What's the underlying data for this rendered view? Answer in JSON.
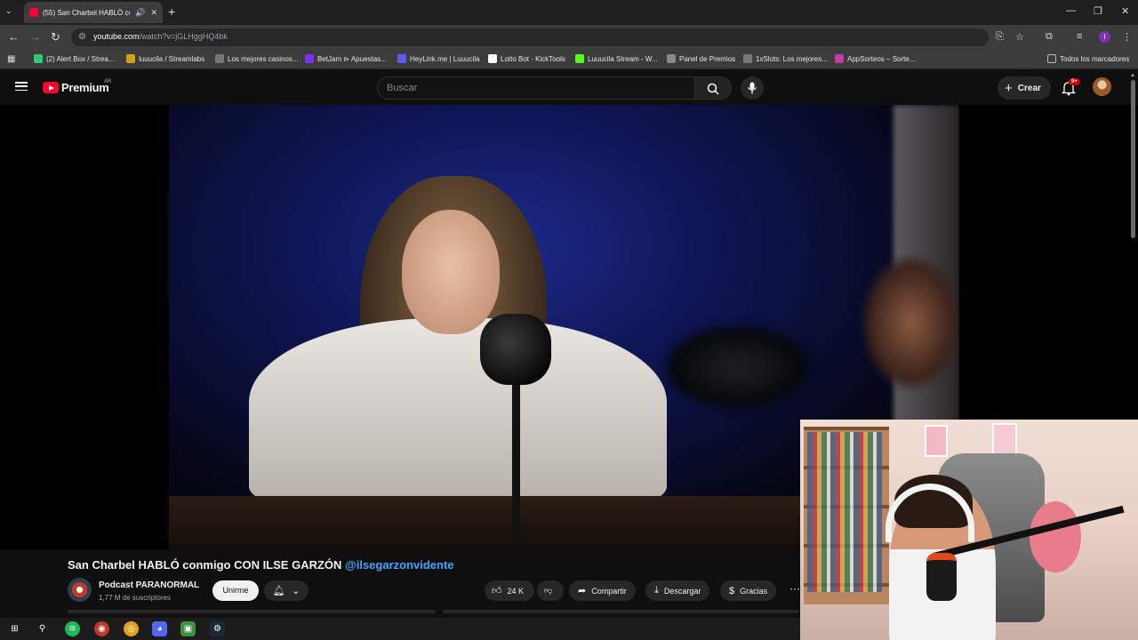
{
  "browser": {
    "tab_title": "(55) San Charbel HABLÓ co",
    "url_host": "youtube.com",
    "url_path": "/watch?v=jGLHggHQ4bk",
    "bookmarks": [
      {
        "label": "(2) Alert Box / Strea...",
        "color": "#2ecc71"
      },
      {
        "label": "luuucila / Streamlabs",
        "color": "#d4a017"
      },
      {
        "label": "Los mejores casinos...",
        "color": "#777777"
      },
      {
        "label": "BetJam ⊳ Apuestas...",
        "color": "#7b2ff7"
      },
      {
        "label": "HeyLink.me | Luuucila",
        "color": "#5b5bf0"
      },
      {
        "label": "Lotto Bot - KickTools",
        "color": "#ffffff"
      },
      {
        "label": "Luuucila Stream - W...",
        "color": "#53fc18"
      },
      {
        "label": "Panel de Premios",
        "color": "#888888"
      },
      {
        "label": "1xSlots: Los mejores...",
        "color": "#777777"
      },
      {
        "label": "AppSorteos – Sorte...",
        "color": "#c040a0"
      }
    ],
    "all_bookmarks": "Todos los marcadores",
    "profile_initial": "l"
  },
  "youtube": {
    "brand": "Premium",
    "country": "AR",
    "search_placeholder": "Buscar",
    "create_label": "Crear",
    "notification_count": "9+",
    "accent": "#ff0033",
    "video": {
      "title": "San Charbel HABLÓ conmigo CON ILSE GARZÓN",
      "title_tag": "@ilsegarzonvidente",
      "channel_name": "Podcast PARANORMAL",
      "subscribers": "1,77 M de suscriptores",
      "join_label": "Unirme",
      "likes": "24 K",
      "share_label": "Compartir",
      "download_label": "Descargar",
      "thanks_label": "Gracias",
      "more_label": "···"
    }
  }
}
